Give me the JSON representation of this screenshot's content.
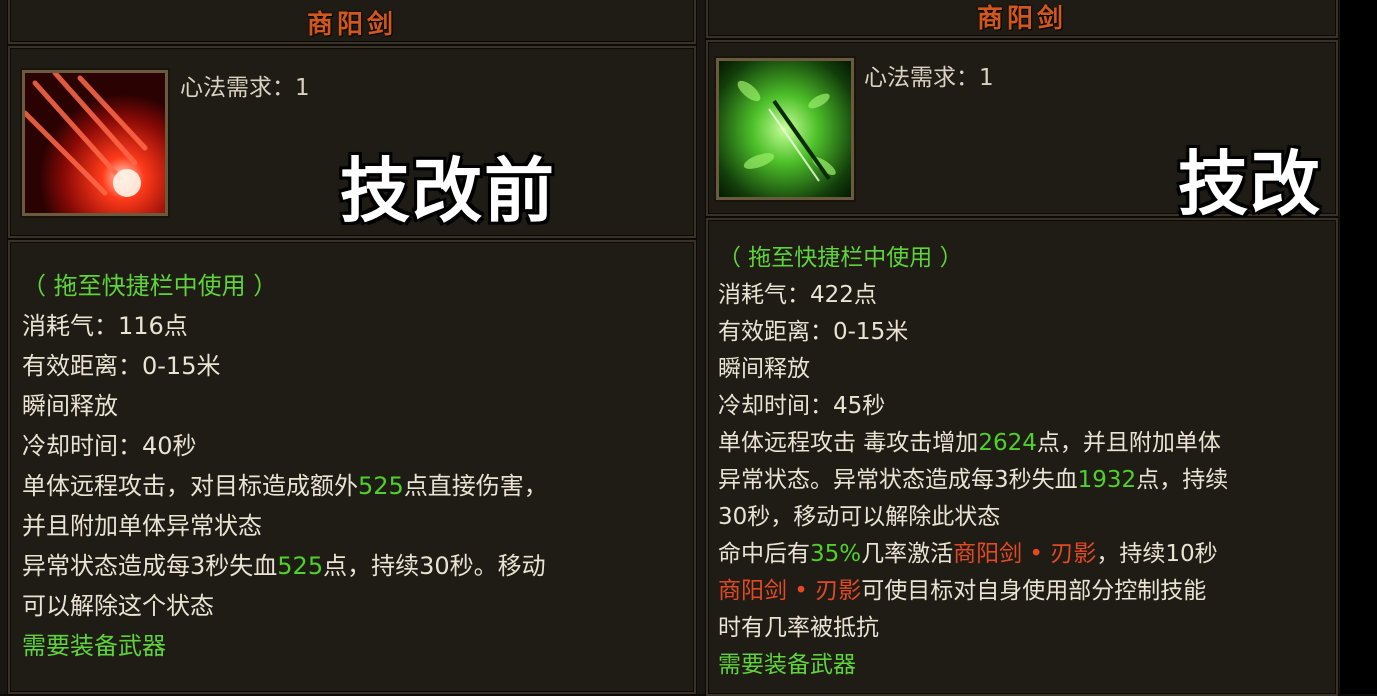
{
  "left": {
    "title": "商阳剑",
    "requirement": "心法需求：1",
    "stamp": "技改前",
    "usage_hint": "（ 拖至快捷栏中使用 ）",
    "qi_cost": "消耗气：116点",
    "range": "有效距离：0-15米",
    "cast": "瞬间释放",
    "cooldown": "冷却时间：40秒",
    "desc1_a": "单体远程攻击，对目标造成额外",
    "desc1_num": "525",
    "desc1_b": "点直接伤害，",
    "desc2": "并且附加单体异常状态",
    "desc3_a": "异常状态造成每3秒失血",
    "desc3_num": "525",
    "desc3_b": "点，持续30秒。移动",
    "desc4": "可以解除这个状态",
    "weapon_req": "需要装备武器",
    "icon": "red-streak-skill-icon"
  },
  "right": {
    "title": "商阳剑",
    "requirement": "心法需求：1",
    "stamp": "技改后",
    "usage_hint": "（ 拖至快捷栏中使用 ）",
    "qi_cost": "消耗气：422点",
    "range": "有效距离：0-15米",
    "cast": "瞬间释放",
    "cooldown": "冷却时间：45秒",
    "desc1_a": "单体远程攻击 毒攻击增加",
    "desc1_num": "2624",
    "desc1_b": "点，并且附加单体",
    "desc2_a": "异常状态。异常状态造成每3秒失血",
    "desc2_num": "1932",
    "desc2_b": "点，持续",
    "desc3": "30秒，移动可以解除此状态",
    "desc4_a": "命中后有",
    "desc4_num": "35%",
    "desc4_b": "几率激活",
    "desc4_skill": "商阳剑 • 刃影",
    "desc4_c": "，持续10秒",
    "desc5_skill": "商阳剑 • 刃影",
    "desc5_b": "可使目标对自身使用部分控制技能",
    "desc6": "时有几率被抵抗",
    "weapon_req": "需要装备武器",
    "icon": "green-streak-skill-icon"
  },
  "colors": {
    "title": "#d2571c",
    "green_text": "#5ed33b",
    "number": "#4fd12a",
    "skill_name": "#e24a25",
    "body_text": "#e9e3d3"
  }
}
